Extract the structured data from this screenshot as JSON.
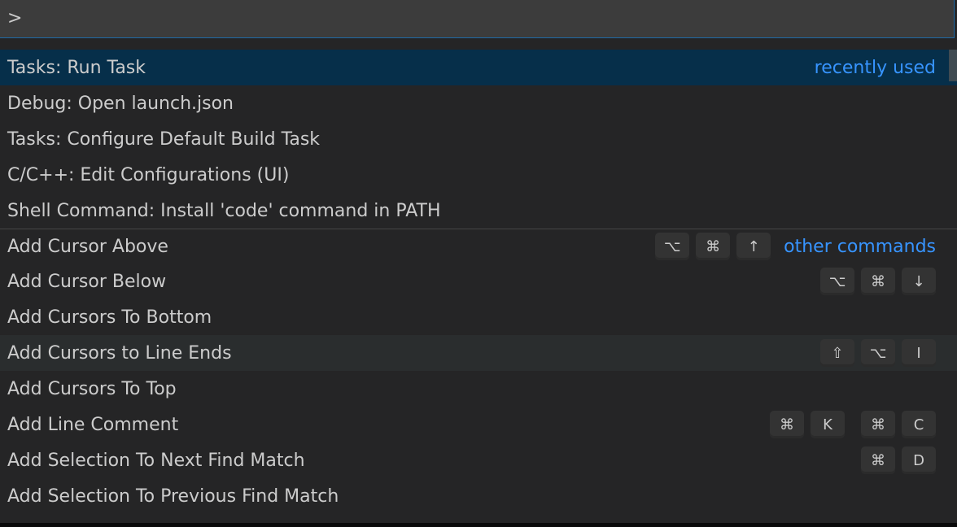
{
  "input": {
    "value": ">",
    "placeholder": ""
  },
  "items": [
    {
      "label": "Tasks: Run Task",
      "tag": "recently used",
      "keys": [],
      "state": "selected"
    },
    {
      "label": "Debug: Open launch.json",
      "keys": []
    },
    {
      "label": "Tasks: Configure Default Build Task",
      "keys": []
    },
    {
      "label": "C/C++: Edit Configurations (UI)",
      "keys": []
    },
    {
      "label": "Shell Command: Install 'code' command in PATH",
      "keys": []
    },
    {
      "label": "Add Cursor Above",
      "tag": "other commands",
      "keys": [
        "⌥",
        "⌘",
        "↑"
      ],
      "separator": true
    },
    {
      "label": "Add Cursor Below",
      "keys": [
        "⌥",
        "⌘",
        "↓"
      ]
    },
    {
      "label": "Add Cursors To Bottom",
      "keys": []
    },
    {
      "label": "Add Cursors to Line Ends",
      "keys": [
        "⇧",
        "⌥",
        "I"
      ],
      "state": "hover"
    },
    {
      "label": "Add Cursors To Top",
      "keys": []
    },
    {
      "label": "Add Line Comment",
      "keys": [
        "⌘",
        "K",
        "⌘",
        "C"
      ],
      "chord": true
    },
    {
      "label": "Add Selection To Next Find Match",
      "keys": [
        "⌘",
        "D"
      ]
    },
    {
      "label": "Add Selection To Previous Find Match",
      "keys": []
    }
  ],
  "colors": {
    "accent": "#3794ff",
    "selected_bg": "#062f4a",
    "background": "#252526"
  }
}
